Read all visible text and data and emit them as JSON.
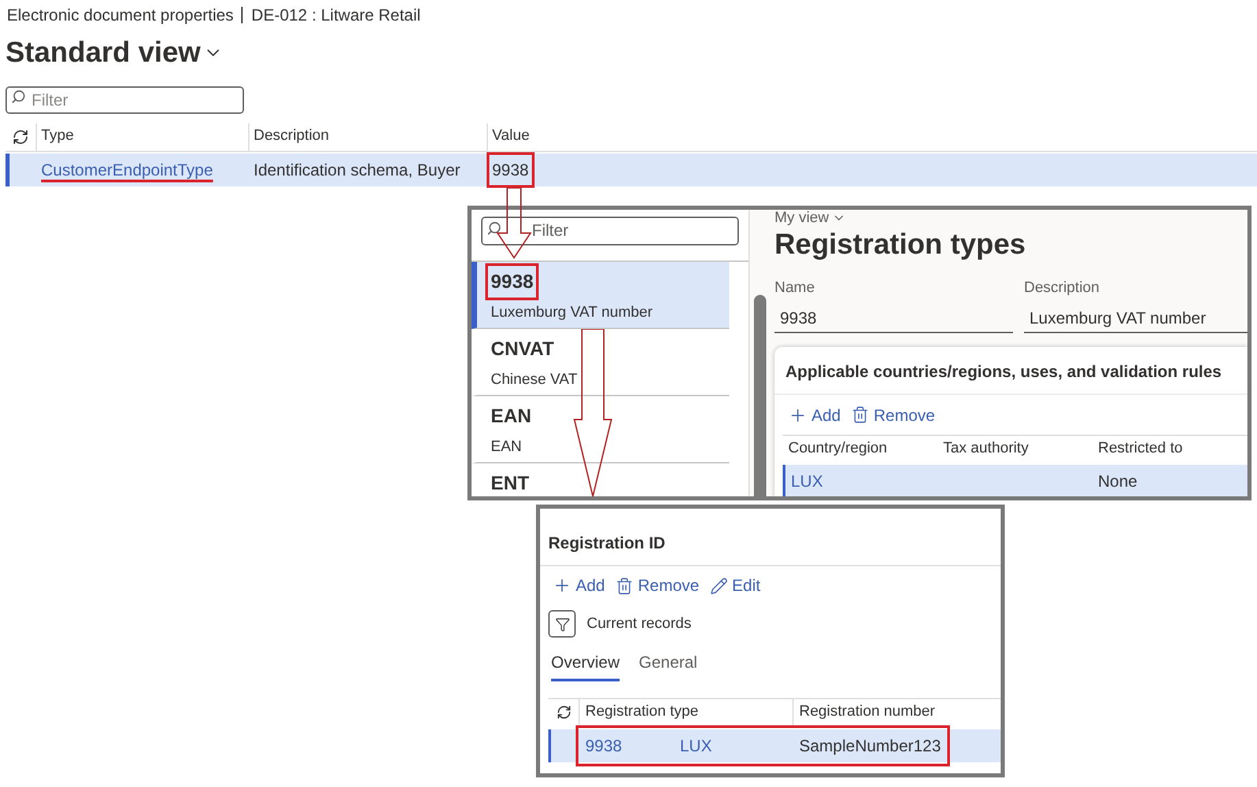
{
  "breadcrumb": {
    "title": "Electronic document properties",
    "record": "DE-012 : Litware Retail"
  },
  "view_title": "Standard view",
  "filter": {
    "placeholder": "Filter"
  },
  "grid": {
    "columns": [
      "Type",
      "Description",
      "Value"
    ],
    "rows": [
      {
        "type": "CustomerEndpointType",
        "description": "Identification schema, Buyer",
        "value": "9938",
        "selected": true,
        "highlighted": true
      }
    ]
  },
  "registration_types_panel": {
    "filter": {
      "placeholder": "Filter"
    },
    "list": [
      {
        "name": "9938",
        "description": "Luxemburg VAT number",
        "selected": true,
        "highlighted": true
      },
      {
        "name": "CNVAT",
        "description": "Chinese VAT",
        "selected": false,
        "highlighted": false
      },
      {
        "name": "EAN",
        "description": "EAN",
        "selected": false,
        "highlighted": false
      },
      {
        "name": "ENT",
        "selected": false,
        "highlighted": false
      }
    ],
    "view_menu": "My view",
    "title": "Registration types",
    "fields": [
      {
        "label": "Name",
        "value": "9938"
      },
      {
        "label": "Description",
        "value": "Luxemburg VAT number"
      }
    ],
    "section": {
      "title": "Applicable countries/regions, uses, and validation rules",
      "actions": [
        {
          "kind": "add",
          "label": "Add"
        },
        {
          "kind": "remove",
          "label": "Remove"
        }
      ],
      "columns": [
        "Country/region",
        "Tax authority",
        "Restricted to"
      ],
      "rows": [
        {
          "country": "LUX",
          "restricted_to": "None",
          "selected": true
        }
      ]
    }
  },
  "registration_id_panel": {
    "title": "Registration ID",
    "actions": [
      {
        "kind": "add",
        "label": "Add"
      },
      {
        "kind": "remove",
        "label": "Remove"
      },
      {
        "kind": "edit",
        "label": "Edit"
      }
    ],
    "filter_label": "Current records",
    "tabs": [
      {
        "label": "Overview",
        "selected": true
      },
      {
        "label": "General",
        "selected": false
      }
    ],
    "columns": [
      "Registration type",
      "Registration number"
    ],
    "rows": [
      {
        "type": "9938",
        "country": "LUX",
        "number": "SampleNumber123",
        "selected": true,
        "highlighted": true
      }
    ]
  }
}
